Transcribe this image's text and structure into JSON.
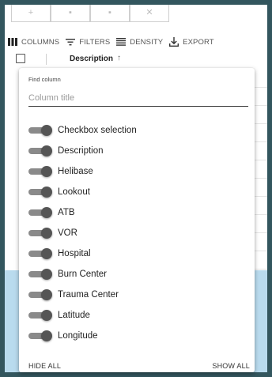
{
  "toolbar": {
    "columns_label": "COLUMNS",
    "filters_label": "FILTERS",
    "density_label": "DENSITY",
    "export_label": "EXPORT"
  },
  "grid_header": {
    "column_title": "Description",
    "sort_icon": "arrow-up-icon"
  },
  "column_panel": {
    "find_label": "Find column",
    "find_placeholder": "Column title",
    "find_value": "",
    "columns": [
      {
        "label": "Checkbox selection",
        "enabled": true
      },
      {
        "label": "Description",
        "enabled": true
      },
      {
        "label": "Helibase",
        "enabled": true
      },
      {
        "label": "Lookout",
        "enabled": true
      },
      {
        "label": "ATB",
        "enabled": true
      },
      {
        "label": "VOR",
        "enabled": true
      },
      {
        "label": "Hospital",
        "enabled": true
      },
      {
        "label": "Burn Center",
        "enabled": true
      },
      {
        "label": "Trauma Center",
        "enabled": true
      },
      {
        "label": "Latitude",
        "enabled": true
      },
      {
        "label": "Longitude",
        "enabled": true
      }
    ],
    "hide_all_label": "HIDE ALL",
    "show_all_label": "SHOW ALL"
  },
  "colors": {
    "background": "#33565e",
    "selected_row": "#b9dbee",
    "switch_thumb": "#555555"
  }
}
